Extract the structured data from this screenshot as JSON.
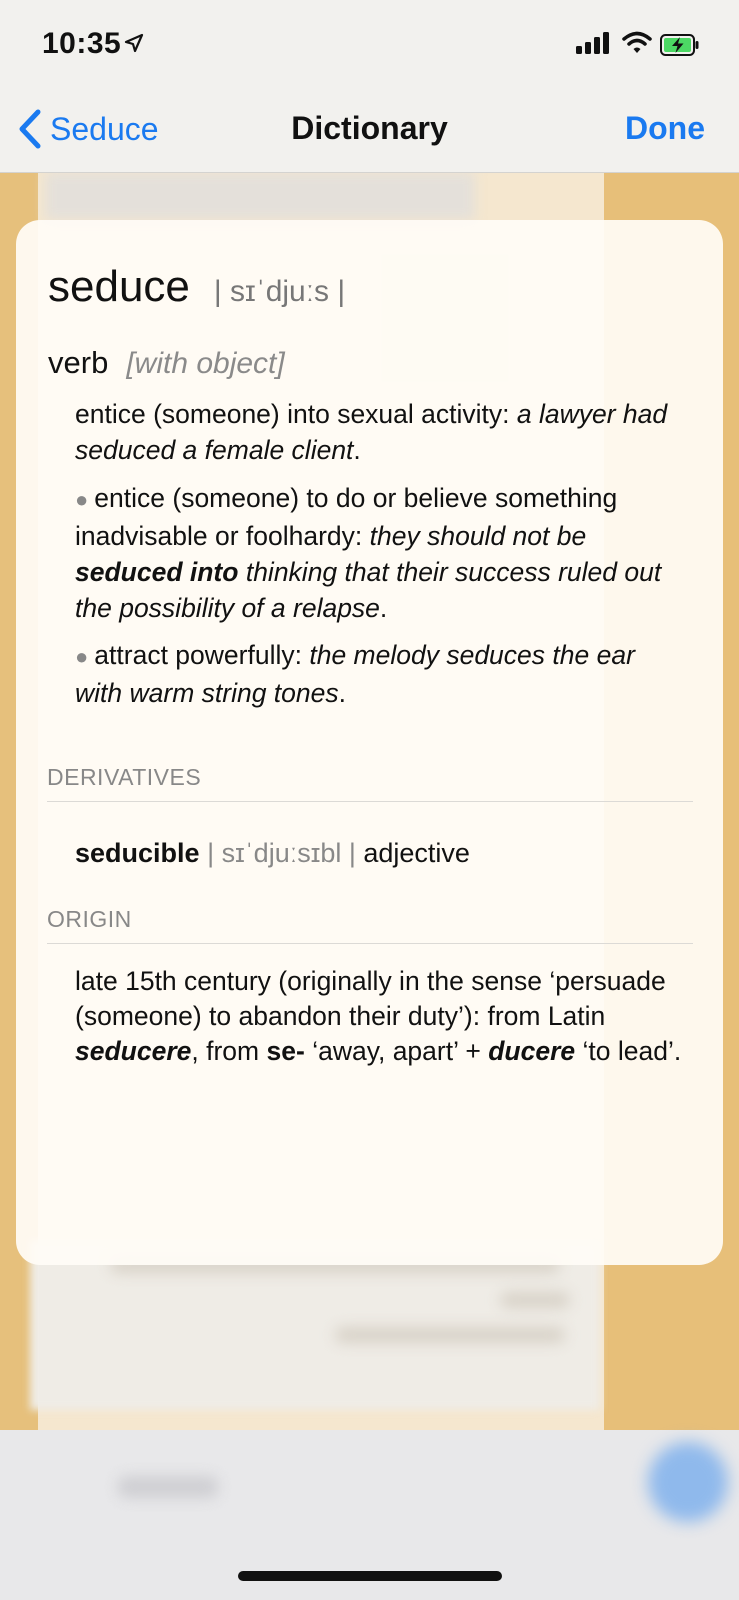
{
  "status_bar": {
    "time": "10:35"
  },
  "nav": {
    "back_label": "Seduce",
    "title": "Dictionary",
    "done_label": "Done"
  },
  "entry": {
    "headword": "seduce",
    "pronunciation": "| sɪˈdjuːs |",
    "part_of_speech": "verb",
    "pos_note": "[with object]",
    "sense_main": {
      "definition": "entice (someone) into sexual activity:",
      "example": "a lawyer had seduced a female client",
      "end": "."
    },
    "sub_senses": [
      {
        "definition": "entice (someone) to do or believe something inadvisable or foolhardy:",
        "example_before": "they should not be",
        "example_bold": "seduced into",
        "example_after": "thinking that their success ruled out the possibility of a relapse",
        "end": "."
      },
      {
        "definition": "attract powerfully:",
        "example": "the melody seduces the ear with warm string tones",
        "end": "."
      }
    ],
    "derivatives_heading": "DERIVATIVES",
    "derivative": {
      "word": "seducible",
      "pronunciation": "| sɪˈdjuːsɪbl |",
      "pos": "adjective"
    },
    "origin_heading": "ORIGIN",
    "origin": {
      "part1": "late 15th century (originally in the sense ‘persuade (someone) to abandon their duty’): from Latin",
      "word1": "seducere",
      "part2": ", from",
      "word2": "se-",
      "part3": "‘away, apart’ +",
      "word3": "ducere",
      "part4": "‘to lead’."
    }
  },
  "colors": {
    "accent": "#1a7af0",
    "background_gold": "#e6c07c"
  }
}
